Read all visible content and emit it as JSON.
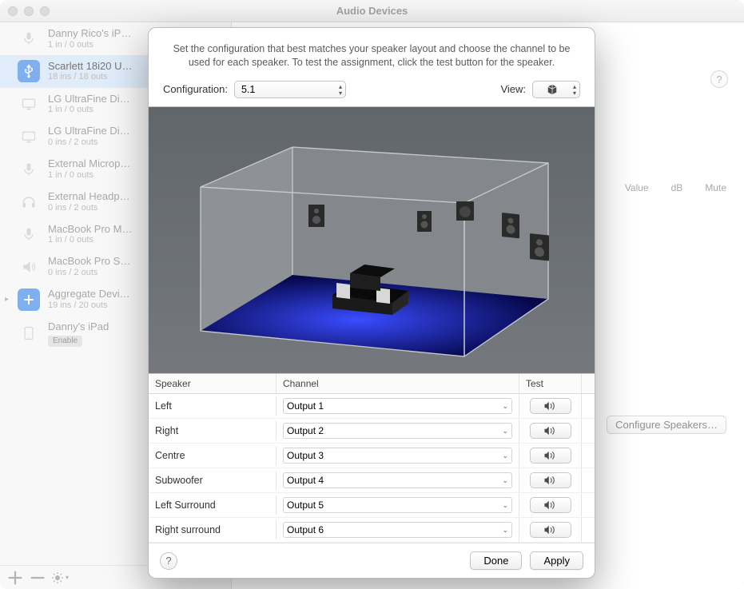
{
  "window": {
    "title": "Audio Devices"
  },
  "sidebar": {
    "devices": [
      {
        "name": "Danny Rico's iP…",
        "sub": "1 in / 0 outs",
        "icon": "mic"
      },
      {
        "name": "Scarlett 18i20 U…",
        "sub": "18 ins / 18 outs",
        "icon": "usb",
        "selected": true
      },
      {
        "name": "LG UltraFine Di…",
        "sub": "1 in / 0 outs",
        "icon": "display"
      },
      {
        "name": "LG UltraFine Di…",
        "sub": "0 ins / 2 outs",
        "icon": "display"
      },
      {
        "name": "External Microp…",
        "sub": "1 in / 0 outs",
        "icon": "mic"
      },
      {
        "name": "External Headp…",
        "sub": "0 ins / 2 outs",
        "icon": "headphones"
      },
      {
        "name": "MacBook Pro M…",
        "sub": "1 in / 0 outs",
        "icon": "mic"
      },
      {
        "name": "MacBook Pro S…",
        "sub": "0 ins / 2 outs",
        "icon": "speaker"
      },
      {
        "name": "Aggregate Devi…",
        "sub": "19 ins / 20 outs",
        "icon": "plus",
        "expand": true
      },
      {
        "name": "Danny's iPad",
        "enable": "Enable",
        "icon": "ipad"
      }
    ]
  },
  "main": {
    "col_value": "Value",
    "col_db": "dB",
    "col_mute": "Mute",
    "configure": "Configure Speakers…"
  },
  "sheet": {
    "desc": "Set the configuration that best matches your speaker layout and choose the channel to be used for each speaker. To test the assignment, click the test button for the speaker.",
    "config_label": "Configuration:",
    "config_value": "5.1",
    "view_label": "View:",
    "headers": {
      "speaker": "Speaker",
      "channel": "Channel",
      "test": "Test"
    },
    "rows": [
      {
        "speaker": "Left",
        "channel": "Output 1"
      },
      {
        "speaker": "Right",
        "channel": "Output 2"
      },
      {
        "speaker": "Centre",
        "channel": "Output 3"
      },
      {
        "speaker": "Subwoofer",
        "channel": "Output 4"
      },
      {
        "speaker": "Left Surround",
        "channel": "Output 5"
      },
      {
        "speaker": "Right surround",
        "channel": "Output 6"
      }
    ],
    "done": "Done",
    "apply": "Apply"
  }
}
